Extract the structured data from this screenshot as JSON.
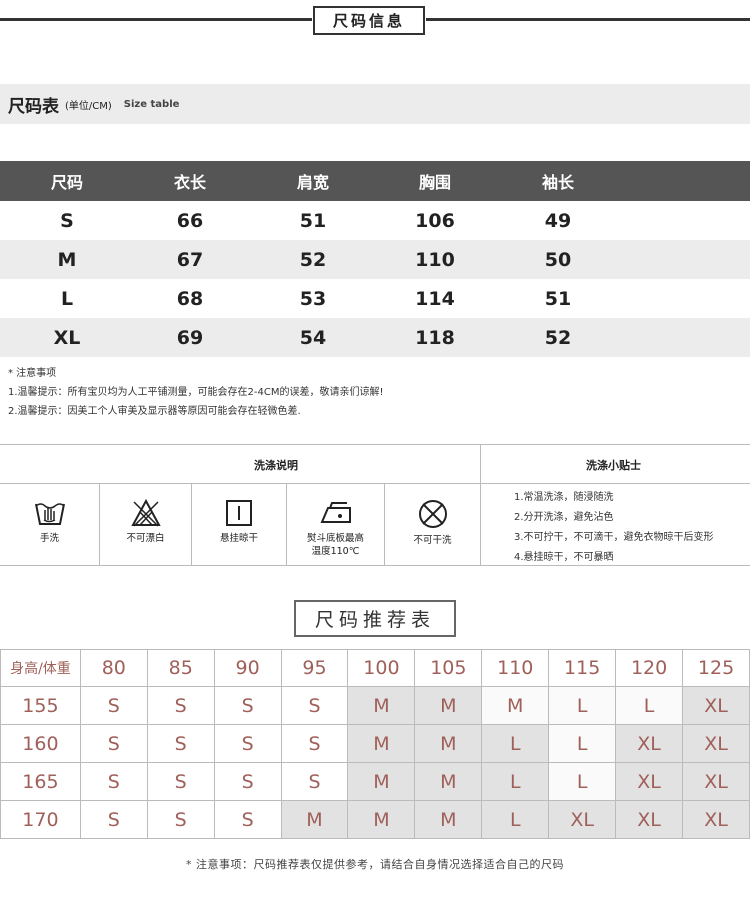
{
  "header": {
    "title": "尺码信息"
  },
  "size_section": {
    "title": "尺码表",
    "unit": "(单位/CM)",
    "english": "Size table"
  },
  "size_table": {
    "columns": [
      "尺码",
      "衣长",
      "肩宽",
      "胸围",
      "袖长"
    ],
    "rows": [
      [
        "S",
        "66",
        "51",
        "106",
        "49"
      ],
      [
        "M",
        "67",
        "52",
        "110",
        "50"
      ],
      [
        "L",
        "68",
        "53",
        "114",
        "51"
      ],
      [
        "XL",
        "69",
        "54",
        "118",
        "52"
      ]
    ]
  },
  "notes": {
    "title": "* 注意事项",
    "line1": "1.温馨提示：所有宝贝均为人工平铺测量，可能会存在2-4CM的误差，敬请亲们谅解!",
    "line2": "2.温馨提示：因美工个人审美及显示器等原因可能会存在轻微色差."
  },
  "wash": {
    "title": "洗涤说明",
    "tips_title": "洗涤小贴士",
    "icons": [
      {
        "icon": "hand-wash-icon",
        "label": "手洗"
      },
      {
        "icon": "no-bleach-icon",
        "label": "不可漂白"
      },
      {
        "icon": "hang-dry-icon",
        "label": "悬挂晾干"
      },
      {
        "icon": "iron-icon",
        "label": "熨斗底板最高",
        "label2": "温度110℃"
      },
      {
        "icon": "no-dry-clean-icon",
        "label": "不可干洗"
      }
    ],
    "tips": [
      "1.常温洗涤，随浸随洗",
      "2.分开洗涤，避免沾色",
      "3.不可拧干，不可滴干，避免衣物晾干后变形",
      "4.悬挂晾干，不可暴晒"
    ]
  },
  "recommend": {
    "title": "尺码推荐表",
    "corner": "身高/体重",
    "weights": [
      "80",
      "85",
      "90",
      "95",
      "100",
      "105",
      "110",
      "115",
      "120",
      "125"
    ],
    "rows": [
      {
        "height": "155",
        "sizes": [
          "S",
          "S",
          "S",
          "S",
          "M",
          "M",
          "M",
          "L",
          "L",
          "XL"
        ]
      },
      {
        "height": "160",
        "sizes": [
          "S",
          "S",
          "S",
          "S",
          "M",
          "M",
          "L",
          "L",
          "XL",
          "XL"
        ]
      },
      {
        "height": "165",
        "sizes": [
          "S",
          "S",
          "S",
          "S",
          "M",
          "M",
          "L",
          "L",
          "XL",
          "XL"
        ]
      },
      {
        "height": "170",
        "sizes": [
          "S",
          "S",
          "S",
          "M",
          "M",
          "M",
          "L",
          "XL",
          "XL",
          "XL"
        ]
      }
    ],
    "footnote": "* 注意事项：尺码推荐表仅提供参考，请结合自身情况选择适合自己的尺码"
  }
}
